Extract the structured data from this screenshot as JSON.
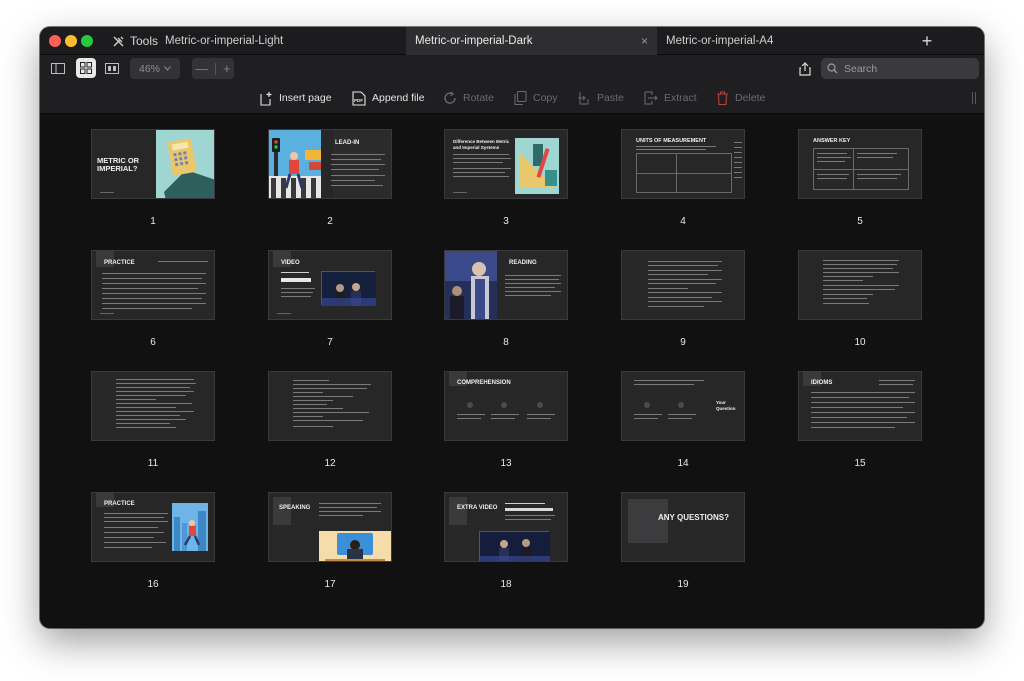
{
  "window": {
    "tools_label": "Tools",
    "tabs": [
      {
        "label": "Metric-or-imperial-Light",
        "active": false
      },
      {
        "label": "Metric-or-imperial-Dark",
        "active": true
      },
      {
        "label": "Metric-or-imperial-A4",
        "active": false
      }
    ],
    "close_glyph": "×",
    "new_tab_glyph": "+"
  },
  "toolbar": {
    "zoom_value": "46%",
    "zoom_minus": "—",
    "zoom_plus": "+",
    "search_placeholder": "Search",
    "actions": [
      {
        "label": "Insert page",
        "icon": "insert-page-icon",
        "enabled": true
      },
      {
        "label": "Append file",
        "icon": "pdf-icon",
        "enabled": true
      },
      {
        "label": "Rotate",
        "icon": "rotate-icon",
        "enabled": false
      },
      {
        "label": "Copy",
        "icon": "copy-icon",
        "enabled": false
      },
      {
        "label": "Paste",
        "icon": "paste-icon",
        "enabled": false
      },
      {
        "label": "Extract",
        "icon": "extract-icon",
        "enabled": false
      },
      {
        "label": "Delete",
        "icon": "trash-icon",
        "enabled": false
      }
    ]
  },
  "pages": [
    {
      "number": "1",
      "title": "METRIC OR IMPERIAL?"
    },
    {
      "number": "2",
      "title": "LEAD-IN"
    },
    {
      "number": "3",
      "title": "Difference Between Metric and Imperial Systems"
    },
    {
      "number": "4",
      "title": "UNITS OF MEASUREMENT"
    },
    {
      "number": "5",
      "title": "ANSWER KEY"
    },
    {
      "number": "6",
      "title": "PRACTICE"
    },
    {
      "number": "7",
      "title": "VIDEO"
    },
    {
      "number": "8",
      "title": "READING"
    },
    {
      "number": "9",
      "title": ""
    },
    {
      "number": "10",
      "title": ""
    },
    {
      "number": "11",
      "title": ""
    },
    {
      "number": "12",
      "title": ""
    },
    {
      "number": "13",
      "title": "COMPREHENSION"
    },
    {
      "number": "14",
      "title": "Your Question"
    },
    {
      "number": "15",
      "title": "IDIOMS"
    },
    {
      "number": "16",
      "title": "PRACTICE"
    },
    {
      "number": "17",
      "title": "SPEAKING"
    },
    {
      "number": "18",
      "title": "EXTRA VIDEO"
    },
    {
      "number": "19",
      "title": "ANY QUESTIONS?"
    }
  ],
  "colors": {
    "window_bg": "#111112",
    "slide_bg": "#272728",
    "accent_teal": "#9fd6d1",
    "accent_red": "#e3453f",
    "accent_blue": "#3a8fd8"
  }
}
